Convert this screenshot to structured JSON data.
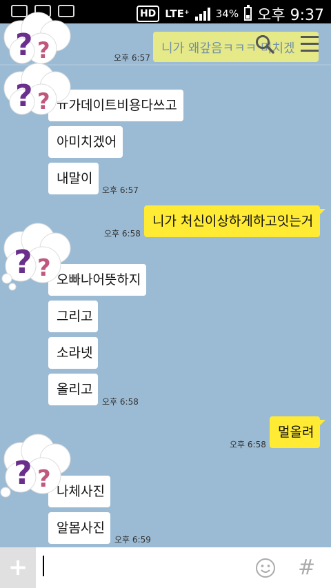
{
  "status_bar": {
    "hd": "HD",
    "lte": "LTE⁺",
    "battery": "34%",
    "time": "오후 9:37"
  },
  "header": {
    "search_text": "니가 왜갚음ㅋㅋㅋ 미치겠"
  },
  "messages": [
    {
      "side": "left",
      "text": "ㅠ가데이트비용다쓰고"
    },
    {
      "side": "left",
      "text": "아미치겠어"
    },
    {
      "side": "left",
      "text": "내말이",
      "time": "오후 6:57"
    },
    {
      "side": "right",
      "text": "니가 처신이상하게하고잇는거",
      "time": "오후 6:58"
    },
    {
      "side": "left",
      "text": "오빠나어뜻하지"
    },
    {
      "side": "left",
      "text": "그리고"
    },
    {
      "side": "left",
      "text": "소라넷"
    },
    {
      "side": "left",
      "text": "올리고",
      "time": "오후 6:58"
    },
    {
      "side": "right",
      "text": "멀올려",
      "time": "오후 6:58"
    },
    {
      "side": "left",
      "text": "나체사진"
    },
    {
      "side": "left",
      "text": "알몸사진",
      "time": "오후 6:59"
    }
  ],
  "top_time": "오후 6:57",
  "input": {
    "plus": "+",
    "hash": "#"
  }
}
